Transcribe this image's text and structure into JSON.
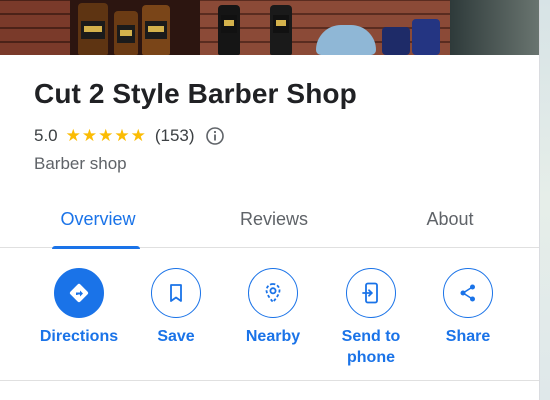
{
  "place": {
    "name": "Cut 2 Style Barber Shop",
    "rating": "5.0",
    "stars": "★★★★★",
    "review_count": "(153)",
    "category": "Barber shop"
  },
  "tabs": [
    {
      "label": "Overview",
      "active": true
    },
    {
      "label": "Reviews",
      "active": false
    },
    {
      "label": "About",
      "active": false
    }
  ],
  "actions": [
    {
      "label": "Directions",
      "icon": "directions-icon"
    },
    {
      "label": "Save",
      "icon": "bookmark-icon"
    },
    {
      "label": "Nearby",
      "icon": "nearby-icon"
    },
    {
      "label": "Send to phone",
      "icon": "send-to-phone-icon"
    },
    {
      "label": "Share",
      "icon": "share-icon"
    }
  ],
  "colors": {
    "accent": "#1a73e8",
    "star": "#fbbc04",
    "text_primary": "#202124",
    "text_secondary": "#5f6368"
  }
}
